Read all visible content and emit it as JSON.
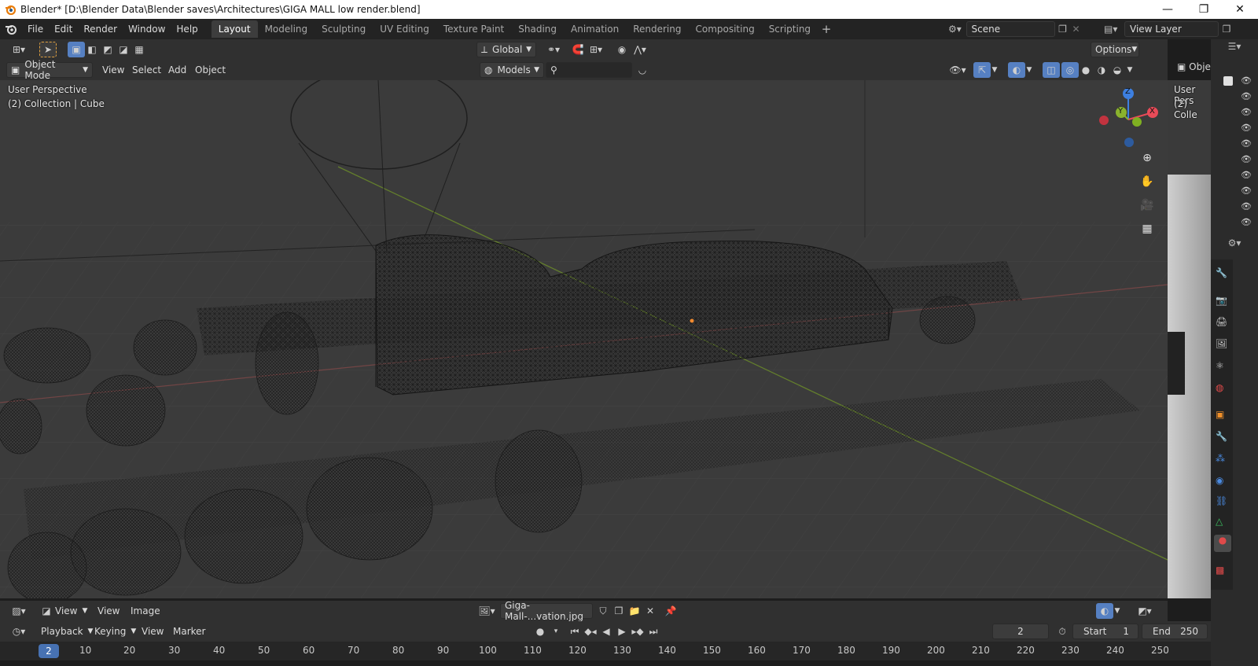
{
  "window": {
    "title": "Blender* [D:\\Blender Data\\Blender saves\\Architectures\\GIGA MALL low render.blend]",
    "minimize": "—",
    "maximize": "❐",
    "close": "✕"
  },
  "menubar": {
    "items": [
      "File",
      "Edit",
      "Render",
      "Window",
      "Help"
    ],
    "workspaces": [
      "Layout",
      "Modeling",
      "Sculpting",
      "UV Editing",
      "Texture Paint",
      "Shading",
      "Animation",
      "Rendering",
      "Compositing",
      "Scripting"
    ],
    "active_workspace": "Layout",
    "add_workspace": "+",
    "scene": "Scene",
    "view_layer": "View Layer"
  },
  "viewport_header": {
    "transform_orientation": "Global",
    "options": "Options",
    "mode": "Object Mode",
    "menus": [
      "View",
      "Select",
      "Add",
      "Object"
    ],
    "collection_filter": "Models",
    "search_placeholder": ""
  },
  "viewport": {
    "perspective_label": "User Perspective",
    "collection_label": "(2) Collection | Cube",
    "side_perspective_label": "User Pers",
    "side_collection_label": "(2) Colle",
    "side_object_label": "Obje",
    "gizmo": {
      "x": "X",
      "y": "Y",
      "z": "Z"
    }
  },
  "image_editor_header": {
    "menus": [
      "View",
      "View",
      "Image"
    ],
    "image_name": "Giga-Mall-...vation.jpg"
  },
  "timeline": {
    "menus": [
      "Playback",
      "Keying",
      "View",
      "Marker"
    ],
    "current_frame": "2",
    "start_label": "Start",
    "start_value": "1",
    "end_label": "End",
    "end_value": "250",
    "ruler_ticks": [
      "10",
      "20",
      "30",
      "40",
      "50",
      "60",
      "70",
      "80",
      "90",
      "100",
      "110",
      "120",
      "130",
      "140",
      "150",
      "160",
      "170",
      "180",
      "190",
      "200",
      "210",
      "220",
      "230",
      "240",
      "250"
    ],
    "ruler_current": "2"
  },
  "colors": {
    "accent": "#4772b3",
    "x_axis": "#e84b58",
    "y_axis": "#8ab32d",
    "z_axis": "#3d7fe0"
  }
}
